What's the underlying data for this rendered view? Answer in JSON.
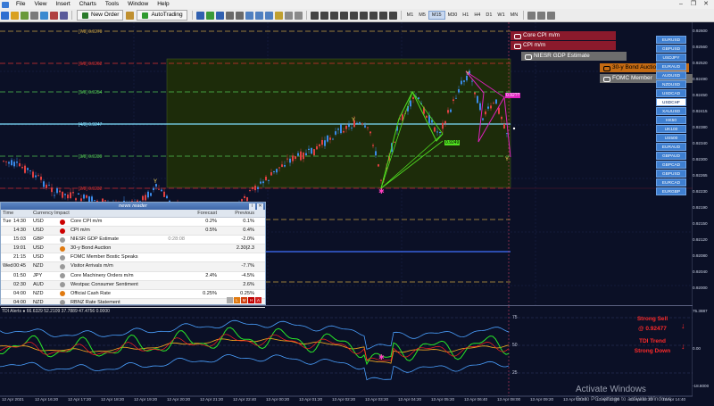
{
  "menu": [
    "File",
    "View",
    "Insert",
    "Charts",
    "Tools",
    "Window",
    "Help"
  ],
  "toolbar": {
    "new_order": "New Order",
    "autotrading": "AutoTrading",
    "timeframes": [
      "M1",
      "M5",
      "M15",
      "M30",
      "H1",
      "H4",
      "D1",
      "W1",
      "MN"
    ],
    "active_tf": "M15"
  },
  "fib_levels": [
    {
      "label": "[7/8]",
      "price": "0.9270"
    },
    {
      "label": "[6/8]",
      "price": "0.9262"
    },
    {
      "label": "[5/8]",
      "price": "0.9254"
    },
    {
      "label": "[4/8]",
      "price": "0.9247"
    },
    {
      "label": "[3/8]",
      "price": "0.9239"
    },
    {
      "label": "[2/8]",
      "price": "0.9232"
    }
  ],
  "chart_labels": {
    "pattern_price": "0.9249",
    "marker_price": "0.92??"
  },
  "calendar_events": [
    {
      "label": "Core CPI m/m",
      "color": "#8b1a2c"
    },
    {
      "label": "CPI m/m",
      "color": "#8b1a2c"
    },
    {
      "label": "NIESR GDP Estimate",
      "color": "#6d6d6d"
    },
    {
      "label": "30-y Bond Auction",
      "color": "#c46a12"
    },
    {
      "label": "FOMC Member",
      "color": "#6d6d6d"
    }
  ],
  "symbols": [
    "EURUSD",
    "GBPUSD",
    "USDJPY",
    "EURAUD",
    "AUDUSD",
    "NZDUSD",
    "USDCAD",
    "USDCHF",
    "XAUUSD",
    "HK50",
    "UK100",
    "US500",
    "EURAUD",
    "GBPAUD",
    "GBPCAD",
    "GBPUSD",
    "EURCAD",
    "EURGBP"
  ],
  "selected_symbol": "USDCHF",
  "price_axis": [
    "0.92600",
    "0.92560",
    "0.92520",
    "0.92490",
    "0.92450",
    "0.92415",
    "0.92380",
    "0.92340",
    "0.92300",
    "0.92265",
    "0.92230",
    "0.92190",
    "0.92150",
    "0.92120",
    "0.92080",
    "0.92040",
    "0.92000"
  ],
  "news_reader": {
    "title": "news reader",
    "headers": {
      "time": "Time",
      "currency": "Currency",
      "impact": "Impact",
      "forecast": "Forecast",
      "previous": "Previous"
    },
    "countdown": "0:28:08",
    "rows": [
      {
        "day": "Tue",
        "time": "14:30",
        "cur": "USD",
        "impact": "#cc0000",
        "event": "Core CPI m/m",
        "forecast": "0.2%",
        "previous": "0.1%"
      },
      {
        "day": "",
        "time": "14:30",
        "cur": "USD",
        "impact": "#cc0000",
        "event": "CPI m/m",
        "forecast": "0.5%",
        "previous": "0.4%"
      },
      {
        "day": "",
        "time": "15:03",
        "cur": "GBP",
        "impact": "#999999",
        "event": "NIESR GDP Estimate",
        "forecast": "",
        "previous": "-2.0%"
      },
      {
        "day": "",
        "time": "19:01",
        "cur": "USD",
        "impact": "#e07a10",
        "event": "30-y Bond Auction",
        "forecast": "",
        "previous": "2.30|2.3"
      },
      {
        "day": "",
        "time": "21:15",
        "cur": "USD",
        "impact": "#999999",
        "event": "FOMC Member Bostic Speaks",
        "forecast": "",
        "previous": ""
      },
      {
        "day": "Wed",
        "time": "00:45",
        "cur": "NZD",
        "impact": "#999999",
        "event": "Visitor Arrivals m/m",
        "forecast": "",
        "previous": "-7.7%"
      },
      {
        "day": "",
        "time": "01:50",
        "cur": "JPY",
        "impact": "#999999",
        "event": "Core Machinery Orders m/m",
        "forecast": "2.4%",
        "previous": "-4.5%"
      },
      {
        "day": "",
        "time": "02:30",
        "cur": "AUD",
        "impact": "#999999",
        "event": "Westpac Consumer Sentiment",
        "forecast": "",
        "previous": "2.6%"
      },
      {
        "day": "",
        "time": "04:00",
        "cur": "NZD",
        "impact": "#e07a10",
        "event": "Official Cash Rate",
        "forecast": "0.25%",
        "previous": "0.25%"
      },
      {
        "day": "",
        "time": "04:00",
        "cur": "NZD",
        "impact": "#999999",
        "event": "RBNZ Rate Statement",
        "forecast": "",
        "previous": ""
      }
    ]
  },
  "indicator": {
    "title": "TDI Alerts ● 66.6329 52.2109 37.7889 47.4756 0.0000",
    "levels": [
      "75",
      "50",
      "25"
    ],
    "right_axis": [
      "75.3887",
      "0.00",
      "-18.8000"
    ],
    "signal_1": "Strong Sell",
    "signal_2": "@ 0.92477",
    "signal_3": "TDI Trend",
    "signal_4": "Strong Down",
    "colors": {
      "green": "#28e828",
      "red": "#ff2020",
      "orange": "#e8a020",
      "blue": "#4aa0ff"
    }
  },
  "x_axis": [
    "12 Apr 2021",
    "12 Apr 16:20",
    "12 Apr 17:20",
    "12 Apr 18:20",
    "12 Apr 19:20",
    "12 Apr 20:20",
    "12 Apr 21:20",
    "12 Apr 22:40",
    "13 Apr 00:20",
    "13 Apr 01:20",
    "13 Apr 02:20",
    "13 Apr 03:20",
    "13 Apr 04:20",
    "13 Apr 05:20",
    "13 Apr 06:40",
    "13 Apr 08:00",
    "13 Apr 09:20",
    "13 Apr 10:40",
    "13 Apr 12:00",
    "13 Apr 13:20",
    "13 Apr 14:40"
  ],
  "watermark": {
    "title": "Activate Windows",
    "subtitle": "Go to PC settings to activate Windows."
  }
}
